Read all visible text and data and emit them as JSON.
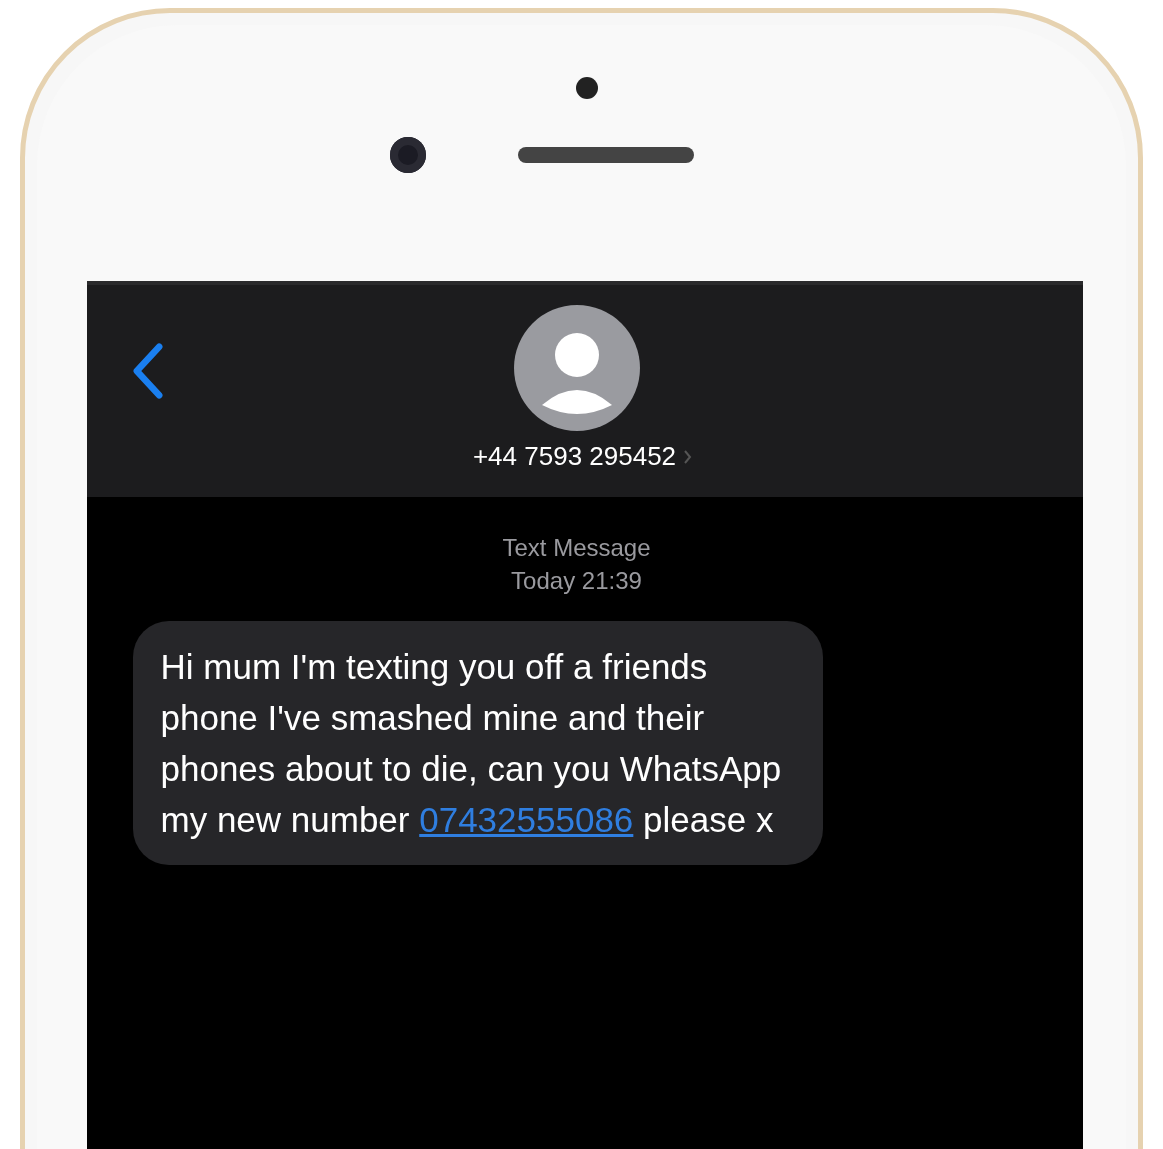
{
  "header": {
    "contact": "+44 7593 295452"
  },
  "timestamp": {
    "label": "Text Message",
    "time": "Today 21:39"
  },
  "message": {
    "text_before": "Hi mum I'm texting you off a friends phone I've smashed mine and their phones about to die, can you WhatsApp my new number",
    "link": "07432555086",
    "text_after": "please x"
  }
}
